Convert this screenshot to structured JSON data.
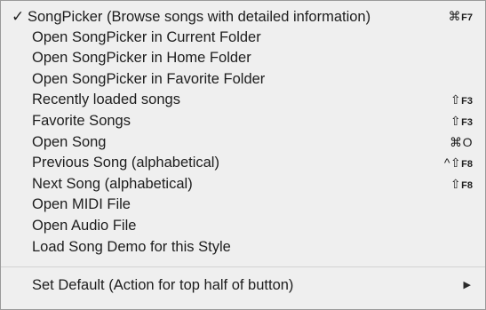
{
  "menu": {
    "items": [
      {
        "label": "SongPicker (Browse songs with detailed information)",
        "checked": true,
        "checkmark": "✓",
        "shortcut_symbol": "⌘",
        "shortcut_key": "F7"
      },
      {
        "label": "Open SongPicker in Current Folder",
        "shortcut_symbol": "",
        "shortcut_key": ""
      },
      {
        "label": "Open SongPicker in Home Folder",
        "shortcut_symbol": "",
        "shortcut_key": ""
      },
      {
        "label": "Open SongPicker in Favorite Folder",
        "shortcut_symbol": "",
        "shortcut_key": ""
      },
      {
        "label": "Recently loaded songs",
        "shortcut_symbol": "⇧",
        "shortcut_key": "F3"
      },
      {
        "label": "Favorite Songs",
        "shortcut_symbol": "⇧",
        "shortcut_key": "F3"
      },
      {
        "label": "Open Song",
        "shortcut_symbol": "⌘",
        "shortcut_key": "O"
      },
      {
        "label": "Previous Song (alphabetical)",
        "shortcut_symbol": "^⇧",
        "shortcut_key": "F8"
      },
      {
        "label": "Next Song (alphabetical)",
        "shortcut_symbol": "⇧",
        "shortcut_key": "F8"
      },
      {
        "label": "Open MIDI File",
        "shortcut_symbol": "",
        "shortcut_key": ""
      },
      {
        "label": "Open Audio File",
        "shortcut_symbol": "",
        "shortcut_key": ""
      },
      {
        "label": "Load Song Demo for this Style",
        "shortcut_symbol": "",
        "shortcut_key": ""
      }
    ],
    "footer_item": {
      "label": "Set Default (Action for top half of button)",
      "submenu_icon": "▶"
    }
  },
  "colors": {
    "menu_background": "#efefef",
    "text": "#1d1d1d",
    "separator": "#d2d2d2"
  },
  "icons": {
    "checkmark": "checkmark-icon",
    "command": "command-key-icon",
    "shift": "shift-key-icon",
    "control": "control-key-icon",
    "submenu": "submenu-arrow-icon"
  }
}
